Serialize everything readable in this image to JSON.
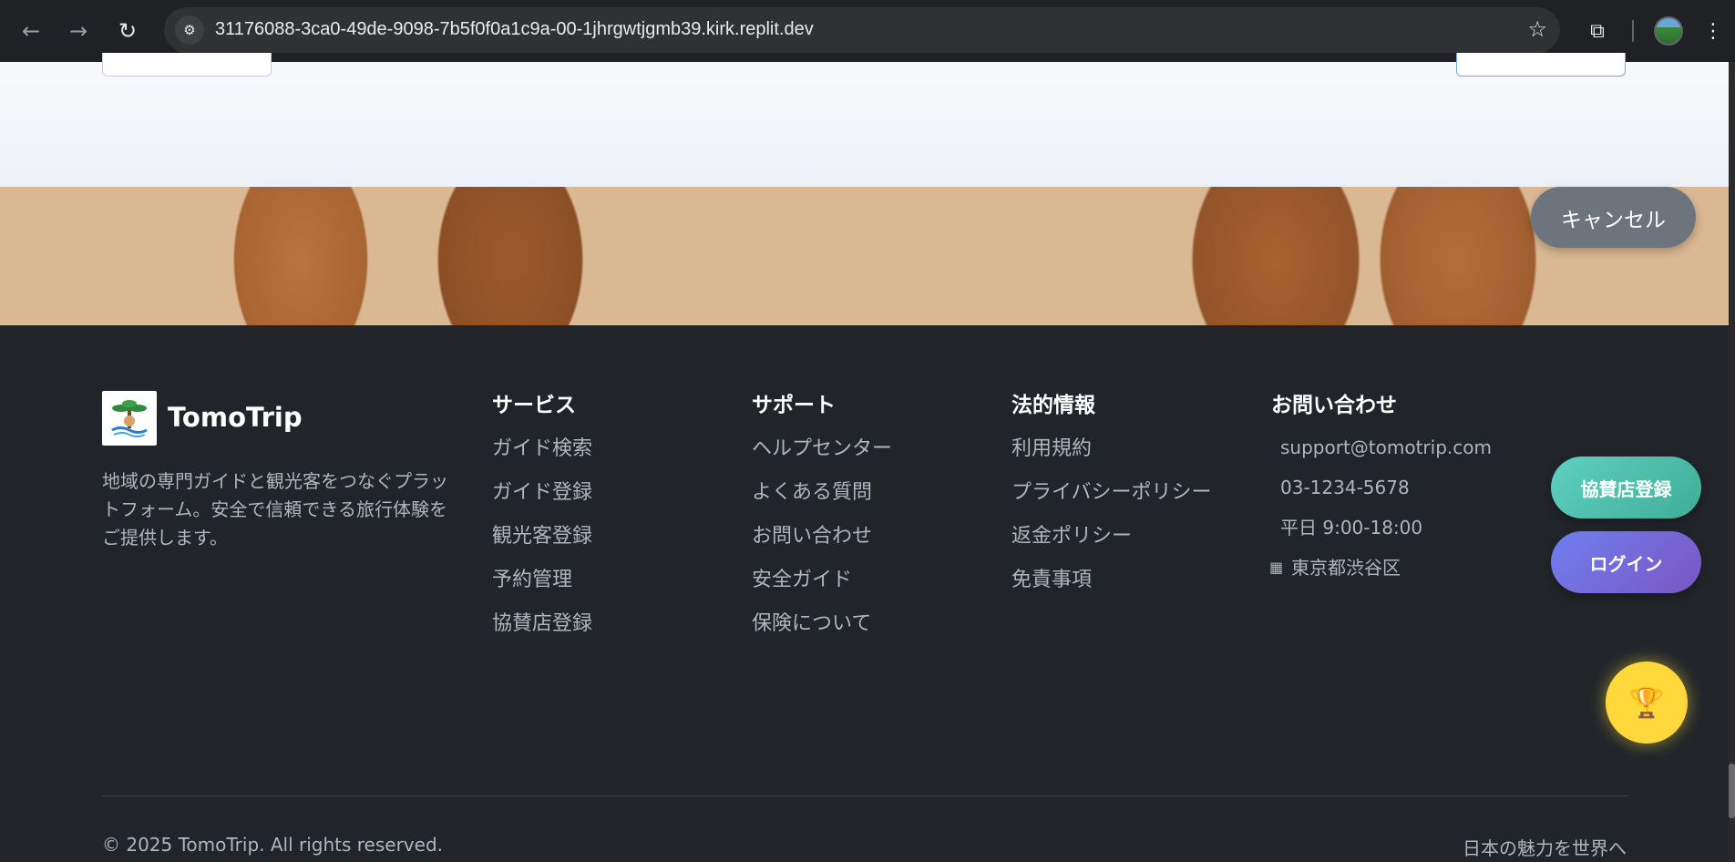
{
  "browser": {
    "url": "31176088-3ca0-49de-9098-7b5f0f0a1c9a-00-1jhrgwtjgmb39.kirk.replit.dev",
    "back_icon": "←",
    "forward_icon": "→",
    "reload_icon": "↻",
    "site_info_icon": "⚙",
    "star_icon": "☆",
    "extensions_icon": "⧉",
    "menu_icon": "⋮"
  },
  "hero": {
    "cancel_label": "キャンセル"
  },
  "footer": {
    "brand": {
      "name": "TomoTrip",
      "description": "地域の専門ガイドと観光客をつなぐプラットフォーム。安全で信頼できる旅行体験をご提供します。",
      "logo_text": "TOMOTRIP"
    },
    "services": {
      "title": "サービス",
      "links": [
        "ガイド検索",
        "ガイド登録",
        "観光客登録",
        "予約管理",
        "協賛店登録"
      ]
    },
    "support": {
      "title": "サポート",
      "links": [
        "ヘルプセンター",
        "よくある質問",
        "お問い合わせ",
        "安全ガイド",
        "保険について"
      ]
    },
    "legal": {
      "title": "法的情報",
      "links": [
        "利用規約",
        "プライバシーポリシー",
        "返金ポリシー",
        "免責事項"
      ]
    },
    "contact": {
      "title": "お問い合わせ",
      "email": "support@tomotrip.com",
      "phone": "03-1234-5678",
      "hours": "平日 9:00-18:00",
      "address": "東京都渋谷区",
      "address_icon": "▦"
    },
    "actions": {
      "sponsor_label": "協賛店登録",
      "login_label": "ログイン",
      "trophy_icon": "🏆"
    },
    "copyright": "© 2025 TomoTrip. All rights reserved.",
    "tagline": "日本の魅力を世界へ"
  }
}
